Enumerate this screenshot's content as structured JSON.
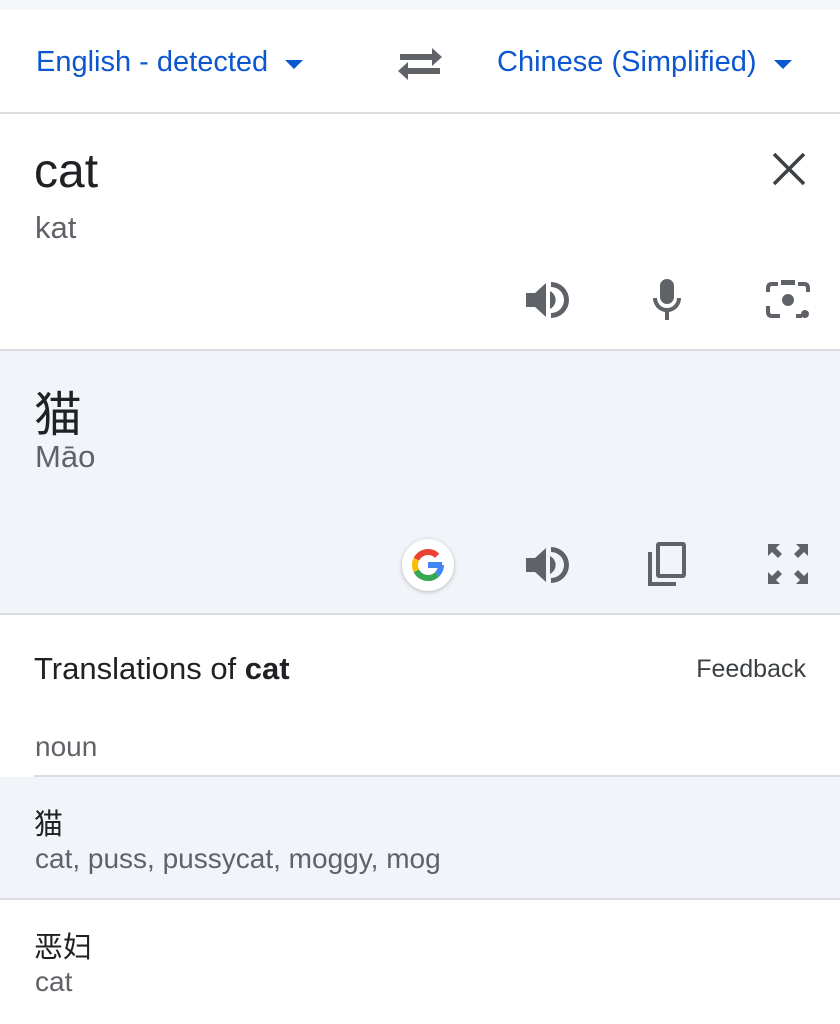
{
  "language_bar": {
    "source_language": "English - detected",
    "target_language": "Chinese (Simplified)"
  },
  "source": {
    "text": "cat",
    "transliteration": "kat",
    "icons": [
      "close-icon",
      "speaker-icon",
      "microphone-icon",
      "camera-icon"
    ]
  },
  "target": {
    "text": "猫",
    "transliteration": "Māo",
    "icons": [
      "google-logo-icon",
      "speaker-icon",
      "copy-icon",
      "fullscreen-icon"
    ]
  },
  "translations": {
    "title_prefix": "Translations of ",
    "title_word": "cat",
    "feedback_label": "Feedback",
    "part_of_speech": "noun",
    "entries": [
      {
        "word": "猫",
        "synonyms": "cat, puss, pussycat, moggy, mog"
      },
      {
        "word": "恶妇",
        "synonyms": "cat"
      }
    ]
  },
  "colors": {
    "accent": "#0b57d0",
    "target_background": "#f1f4f9",
    "divider": "#dadce0",
    "icon": "#5f6368"
  }
}
